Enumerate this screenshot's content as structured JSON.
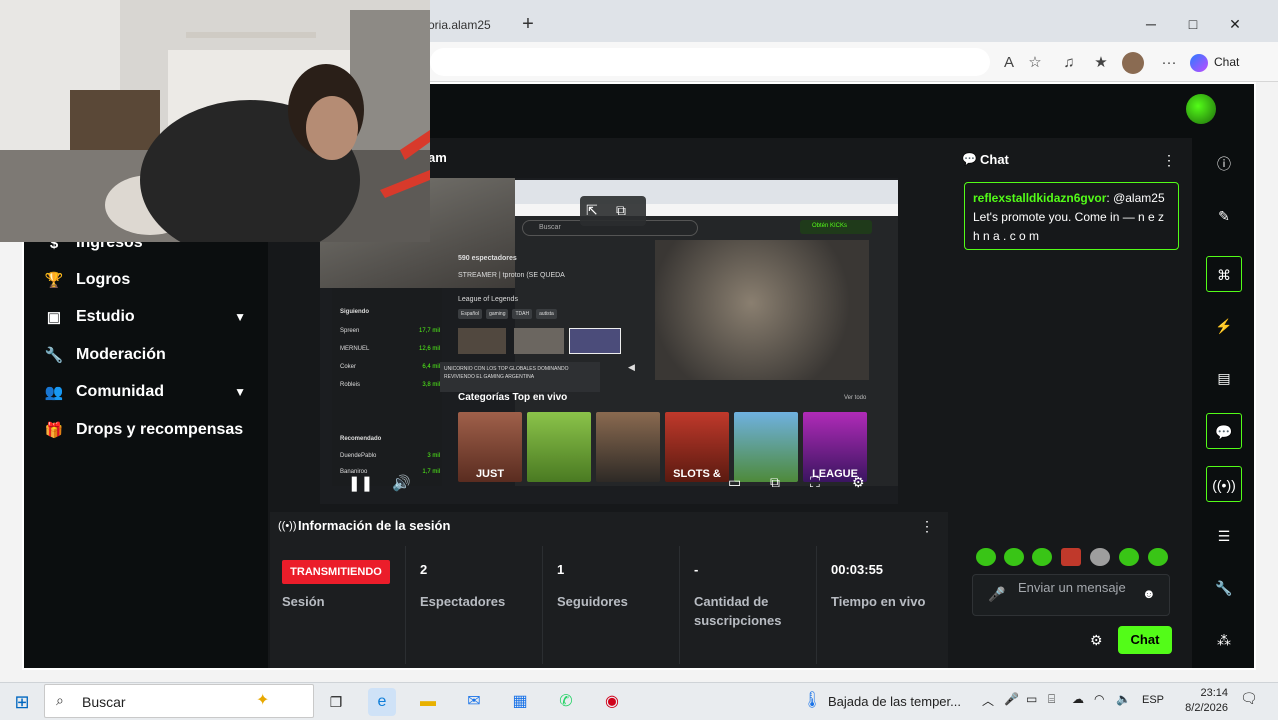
{
  "browser": {
    "tab_title": "oria.alam25",
    "new_tab": "+",
    "window_controls": [
      "─",
      "□",
      "✕"
    ],
    "copilot_label": "Chat"
  },
  "sidebar": {
    "items": [
      {
        "label": "Ingresos",
        "icon": "money-icon"
      },
      {
        "label": "Logros",
        "icon": "trophy-icon"
      },
      {
        "label": "Estudio",
        "icon": "studio-icon",
        "expandable": true
      },
      {
        "label": "Moderación",
        "icon": "wrench-icon"
      },
      {
        "label": "Comunidad",
        "icon": "community-icon",
        "expandable": true
      },
      {
        "label": "Drops y recompensas",
        "icon": "gift-icon"
      }
    ]
  },
  "stream": {
    "title_fragment": "am"
  },
  "preview": {
    "viewers": "590 espectadores",
    "streamer_line": "STREAMER | tproton (SE QUEDA",
    "game": "League of Legends",
    "tags": [
      "Español",
      "gaming",
      "TDAH",
      "autista"
    ],
    "search_placeholder": "Buscar",
    "kicks_button": "Obtén KICKs",
    "section_title": "Categorías Top en vivo",
    "ver_todo": "Ver todo",
    "following_header": "Siguiendo",
    "following": [
      {
        "name": "Spreen",
        "count": "17,7 mil"
      },
      {
        "name": "MERNUEL",
        "count": "12,6 mil"
      },
      {
        "name": "Coker",
        "count": "6,4 mil"
      },
      {
        "name": "Robleis",
        "count": "3,8 mil"
      }
    ],
    "recommended_header": "Recomendado",
    "recommended": [
      {
        "name": "DuendePablo",
        "count": "3 mil"
      },
      {
        "name": "Bananiroo",
        "count": "1,7 mil"
      }
    ],
    "banner": "UNICORNIO CON LOS TOP GLOBALES DOMINANDO REVIVIENDO EL GAMING ARGENTINA",
    "categories": [
      "JUST",
      "",
      "",
      "SLOTS &",
      "",
      "LEAGUE"
    ]
  },
  "session": {
    "title": "Información de la sesión",
    "badge": "TRANSMITIENDO",
    "badge_label": "Sesión",
    "stats": [
      {
        "value": "2",
        "label": "Espectadores"
      },
      {
        "value": "1",
        "label": "Seguidores"
      },
      {
        "value": "-",
        "label": "Cantidad de suscripciones"
      },
      {
        "value": "00:03:55",
        "label": "Tiempo en vivo"
      }
    ]
  },
  "chat": {
    "title": "Chat",
    "message_user": "reflexstalldkidazn6gvor",
    "message_text": "@alam25 Let's promote you. Come in — n e z h n a . c o m",
    "input_placeholder": "Enviar un mensaje",
    "send_label": "Chat"
  },
  "taskbar": {
    "search": "Buscar",
    "weather": "Bajada de las temper...",
    "lang": "ESP",
    "time": "23:14",
    "date": "8/2/2026"
  },
  "colors": {
    "accent": "#53fc18",
    "live": "#eb1d2a",
    "bg": "#16181a"
  }
}
